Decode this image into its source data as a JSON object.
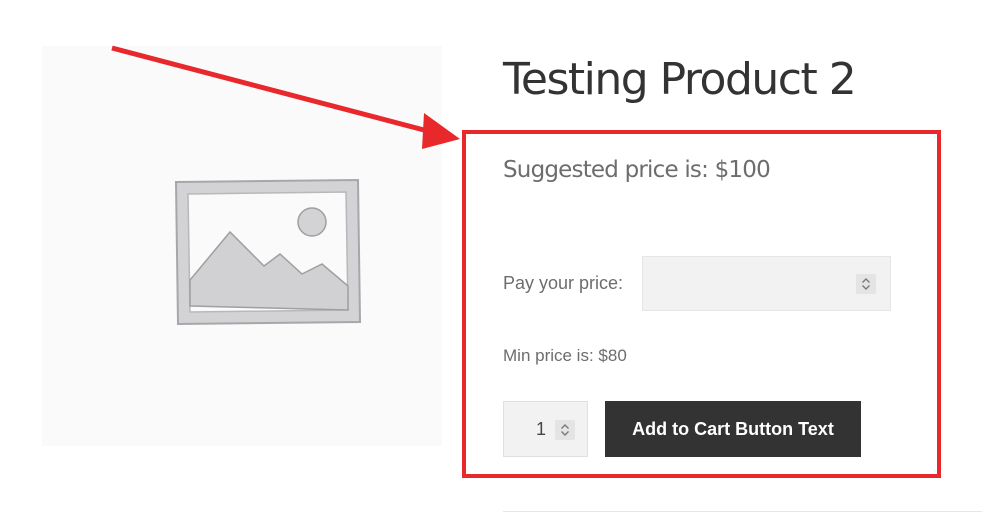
{
  "product": {
    "title": "Testing Product 2"
  },
  "pricing": {
    "suggested_text": "Suggested price is: $100",
    "pay_label": "Pay your price:",
    "pay_value": "",
    "min_text": "Min price is: $80"
  },
  "cart": {
    "quantity": "1",
    "button_label": "Add to Cart Button Text"
  },
  "colors": {
    "annotation": "#e8282b",
    "button_bg": "#333333",
    "button_text": "#ffffff",
    "muted_text": "#6d6d6d",
    "field_bg": "#f2f2f2"
  },
  "icons": {
    "image": "image-placeholder-icon",
    "stepper": "chevron-up-down-icon",
    "annotation": "arrow-icon"
  }
}
